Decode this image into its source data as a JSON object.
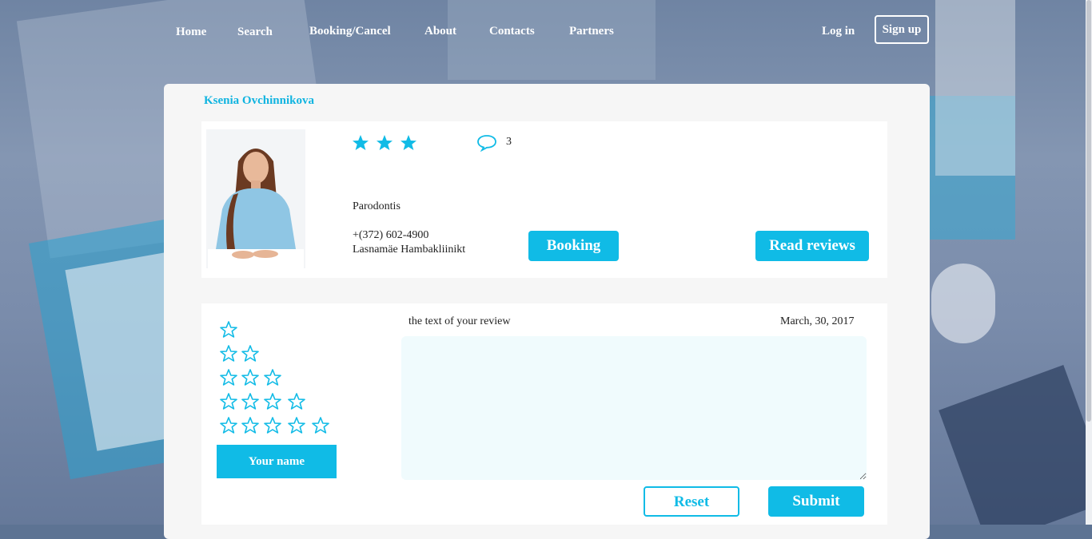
{
  "nav": {
    "items": [
      "Home",
      "Search",
      "Booking/Cancel",
      "About",
      "Contacts",
      "Partners"
    ],
    "login": "Log in",
    "signup": "Sign up"
  },
  "doctor": {
    "name": "Ksenia Ovchinnikova",
    "rating": 3,
    "review_count": "3",
    "specialty": "Parodontis",
    "phone": "+(372) 602-4900",
    "clinic": "Lasnamäe Hambakliinikt",
    "booking_label": "Booking",
    "read_reviews_label": "Read reviews"
  },
  "review_form": {
    "star_options": [
      1,
      2,
      3,
      4,
      5
    ],
    "name_label": "Your name",
    "text_label": "the text of your review",
    "date": "March, 30, 2017",
    "reset_label": "Reset",
    "submit_label": "Submit"
  },
  "colors": {
    "accent": "#10bbe6",
    "card_bg": "#f6f6f6",
    "textarea_bg": "#f0fbfd"
  }
}
